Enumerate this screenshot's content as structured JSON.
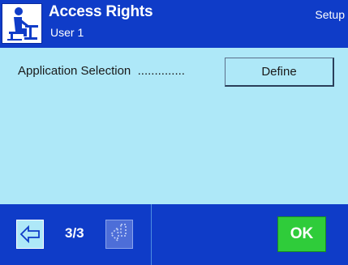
{
  "header": {
    "title": "Access Rights",
    "subtitle": "User 1",
    "mode": "Setup",
    "icon": "balance-user-icon"
  },
  "content": {
    "rows": [
      {
        "label": "Application Selection",
        "leader": "..............",
        "button_label": "Define"
      }
    ]
  },
  "footer": {
    "prev_icon": "arrow-left-icon",
    "page": "3/3",
    "next_icon": "arrow-down-left-icon",
    "ok_label": "OK"
  },
  "colors": {
    "header_bg": "#0f3cc8",
    "content_bg": "#aee8f8",
    "ok_bg": "#2fcc3a"
  }
}
